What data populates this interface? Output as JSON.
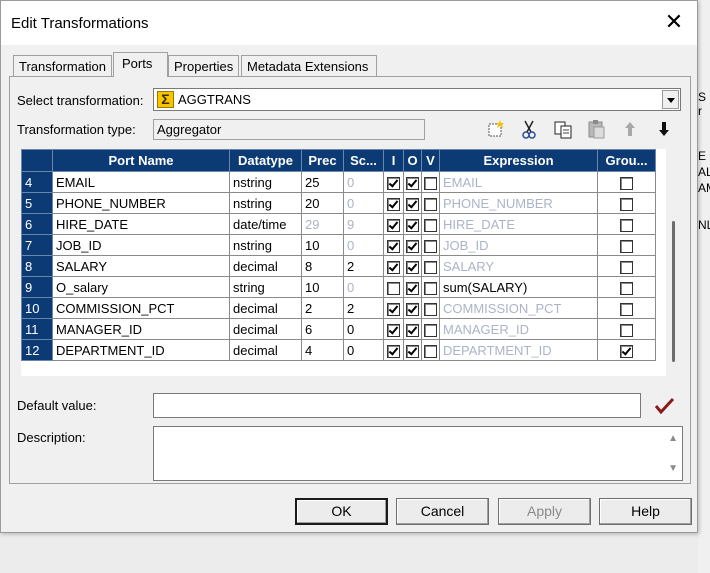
{
  "dialog": {
    "title": "Edit Transformations",
    "tabs": [
      {
        "label": "Transformation",
        "active": false
      },
      {
        "label": "Ports",
        "active": true
      },
      {
        "label": "Properties",
        "active": false
      },
      {
        "label": "Metadata Extensions",
        "active": false
      }
    ]
  },
  "background_text": [
    "S",
    "r",
    "E",
    "AL",
    "AM",
    "NL"
  ],
  "select_transformation": {
    "label": "Select transformation:",
    "value": "AGGTRANS",
    "icon": "sigma-icon"
  },
  "transformation_type": {
    "label": "Transformation type:",
    "value": "Aggregator"
  },
  "toolbar": {
    "icons": [
      "new-port-icon",
      "cut-icon",
      "copy-icon",
      "paste-icon",
      "move-up-icon",
      "move-down-icon"
    ]
  },
  "ports": {
    "columns": [
      "",
      "Port Name",
      "Datatype",
      "Prec",
      "Sc...",
      "I",
      "O",
      "V",
      "Expression",
      "Grou..."
    ],
    "rows": [
      {
        "num": "4",
        "name": "EMAIL",
        "datatype": "nstring",
        "prec": "25",
        "prec_dim": false,
        "scale": "0",
        "scale_dim": true,
        "i": true,
        "o": true,
        "v": false,
        "expr": "EMAIL",
        "expr_dim": true,
        "group": false
      },
      {
        "num": "5",
        "name": "PHONE_NUMBER",
        "datatype": "nstring",
        "prec": "20",
        "prec_dim": false,
        "scale": "0",
        "scale_dim": true,
        "i": true,
        "o": true,
        "v": false,
        "expr": "PHONE_NUMBER",
        "expr_dim": true,
        "group": false
      },
      {
        "num": "6",
        "name": "HIRE_DATE",
        "datatype": "date/time",
        "prec": "29",
        "prec_dim": true,
        "scale": "9",
        "scale_dim": true,
        "i": true,
        "o": true,
        "v": false,
        "expr": "HIRE_DATE",
        "expr_dim": true,
        "group": false
      },
      {
        "num": "7",
        "name": "JOB_ID",
        "datatype": "nstring",
        "prec": "10",
        "prec_dim": false,
        "scale": "0",
        "scale_dim": true,
        "i": true,
        "o": true,
        "v": false,
        "expr": "JOB_ID",
        "expr_dim": true,
        "group": false
      },
      {
        "num": "8",
        "name": "SALARY",
        "datatype": "decimal",
        "prec": "8",
        "prec_dim": false,
        "scale": "2",
        "scale_dim": false,
        "i": true,
        "o": true,
        "v": false,
        "expr": "SALARY",
        "expr_dim": true,
        "group": false
      },
      {
        "num": "9",
        "name": "O_salary",
        "datatype": "string",
        "prec": "10",
        "prec_dim": false,
        "scale": "0",
        "scale_dim": true,
        "i": false,
        "o": true,
        "v": false,
        "expr": "sum(SALARY)",
        "expr_dim": false,
        "group": false
      },
      {
        "num": "10",
        "name": "COMMISSION_PCT",
        "datatype": "decimal",
        "prec": "2",
        "prec_dim": false,
        "scale": "2",
        "scale_dim": false,
        "i": true,
        "o": true,
        "v": false,
        "expr": "COMMISSION_PCT",
        "expr_dim": true,
        "group": false
      },
      {
        "num": "11",
        "name": "MANAGER_ID",
        "datatype": "decimal",
        "prec": "6",
        "prec_dim": false,
        "scale": "0",
        "scale_dim": false,
        "i": true,
        "o": true,
        "v": false,
        "expr": "MANAGER_ID",
        "expr_dim": true,
        "group": false
      },
      {
        "num": "12",
        "name": "DEPARTMENT_ID",
        "datatype": "decimal",
        "prec": "4",
        "prec_dim": false,
        "scale": "0",
        "scale_dim": false,
        "i": true,
        "o": true,
        "v": false,
        "expr": "DEPARTMENT_ID",
        "expr_dim": true,
        "group": true
      }
    ]
  },
  "default_value": {
    "label": "Default value:",
    "value": ""
  },
  "description": {
    "label": "Description:",
    "value": ""
  },
  "buttons": [
    {
      "label": "OK",
      "name": "ok-button",
      "enabled": true,
      "default": true
    },
    {
      "label": "Cancel",
      "name": "cancel-button",
      "enabled": true,
      "default": false
    },
    {
      "label": "Apply",
      "name": "apply-button",
      "enabled": false,
      "default": false
    },
    {
      "label": "Help",
      "name": "help-button",
      "enabled": true,
      "default": false
    }
  ],
  "colors": {
    "header_bg": "#0c3a74",
    "dim_text": "#aab4c8",
    "validate_check": "#8b1a1a"
  }
}
